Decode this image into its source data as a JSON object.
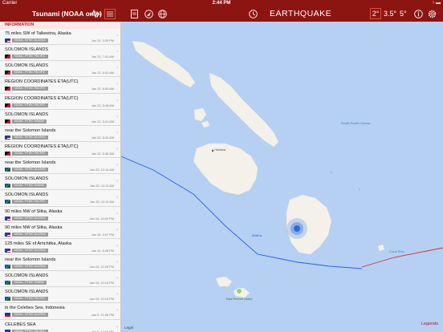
{
  "status": {
    "carrier": "Carrier",
    "time": "2:44 PM",
    "battery": "↑ ▬"
  },
  "nav": {
    "title_left": "Tsunami (NOAA only)",
    "title_center": "EARTHQUAKE",
    "mag_selected": "2°",
    "mag_mid": "3.5°",
    "mag_high": "5°",
    "icons": [
      "wave-icon",
      "list-icon",
      "pdf-icon",
      "location-icon",
      "globe-icon",
      "history-icon",
      "info-icon",
      "settings-icon"
    ]
  },
  "sidebar": {
    "section": "INFORMATION",
    "items": [
      {
        "title": "75 miles SW of Talkeetna, Alaska",
        "flag": "us",
        "source": "NOAA - NTWC ALASKA",
        "date": "Jan 29, 3:33 PM"
      },
      {
        "title": "SOLOMON ISLANDS",
        "flag": "png",
        "source": "NOAA - PTWC PACIFIC",
        "date": "Jan 22, 7:41 AM"
      },
      {
        "title": "SOLOMON ISLANDS",
        "flag": "png",
        "source": "NOAA - PTWC PACIFIC",
        "date": "Jan 22, 6:41 AM"
      },
      {
        "title": "REGION COORDINATES ETA(UTC)",
        "flag": "png",
        "source": "NOAA - PTWC PACIFIC",
        "date": "Jan 22, 6:00 AM"
      },
      {
        "title": "REGION COORDINATES ETA(UTC)",
        "flag": "png",
        "source": "NOAA - PTWC PACIFIC",
        "date": "Jan 22, 5:48 AM"
      },
      {
        "title": "SOLOMON ISLANDS",
        "flag": "png",
        "source": "NOAA - PTWC HAWAII",
        "date": "Jan 22, 5:41 AM"
      },
      {
        "title": "near the Solomon Islands",
        "flag": "us",
        "source": "NOAA - NTWC ALASKA",
        "date": "Jan 22, 5:40 AM"
      },
      {
        "title": "REGION COORDINATES ETA(UTC)",
        "flag": "png",
        "source": "NOAA - PTWC PACIFIC",
        "date": "Jan 22, 5:38 AM"
      },
      {
        "title": "near the Solomon Islands",
        "flag": "sb",
        "source": "NOAA - NTWC ALASKA",
        "date": "Jan 20, 12:14 AM"
      },
      {
        "title": "SOLOMON ISLANDS",
        "flag": "sb",
        "source": "NOAA - PTWC HAWAII",
        "date": "Jan 20, 12:11 AM"
      },
      {
        "title": "SOLOMON ISLANDS",
        "flag": "sb",
        "source": "NOAA - PTWC PACIFIC",
        "date": "Jan 20, 12:11 AM"
      },
      {
        "title": "90 miles NW of Sitka, Alaska",
        "flag": "us",
        "source": "NOAA - NTWC ALASKA",
        "date": "Jan 16, 10:42 PM"
      },
      {
        "title": "90 miles NW of Sitka, Alaska",
        "flag": "us",
        "source": "NOAA - NTWC ALASKA",
        "date": "Jan 16, 9:57 PM"
      },
      {
        "title": "125 miles SE of Amchitka, Alaska",
        "flag": "us",
        "source": "NOAA - NTWC ALASKA",
        "date": "Jan 11, 8:48 PM"
      },
      {
        "title": "near the Solomon Islands",
        "flag": "sb",
        "source": "NOAA - NTWC ALASKA",
        "date": "Jan 10, 12:26 PM"
      },
      {
        "title": "SOLOMON ISLANDS",
        "flag": "sb",
        "source": "NOAA - PTWC HAWAII",
        "date": "Jan 10, 12:16 PM"
      },
      {
        "title": "SOLOMON ISLANDS",
        "flag": "sb",
        "source": "NOAA - PTWC PACIFIC",
        "date": "Jan 10, 12:16 PM"
      },
      {
        "title": "in the Celebes Sea, Indonesia",
        "flag": "ph",
        "source": "NOAA - NTWC ALASKA",
        "date": "Jan 5, 12:36 PM"
      },
      {
        "title": "CELEBES SEA",
        "flag": "ph",
        "source": "NOAA - PTWC PACIFIC",
        "date": "Jan 5, 12:10 PM"
      }
    ]
  },
  "map": {
    "labels": {
      "honiara": "Honiara",
      "south_pacific_ocean": "South Pacific Ocean",
      "makira": "Makira",
      "coral_sea": "Coral Sea",
      "east_rennell": "East Rennell Island",
      "legal": "Legal",
      "legend": "Legends"
    },
    "colors": {
      "land": "#f3f1ea",
      "ocean": "#b5d0f2",
      "blue_line": "#2f5fe0",
      "red_line": "#d22b2b",
      "quake": "#3d7de6"
    }
  }
}
